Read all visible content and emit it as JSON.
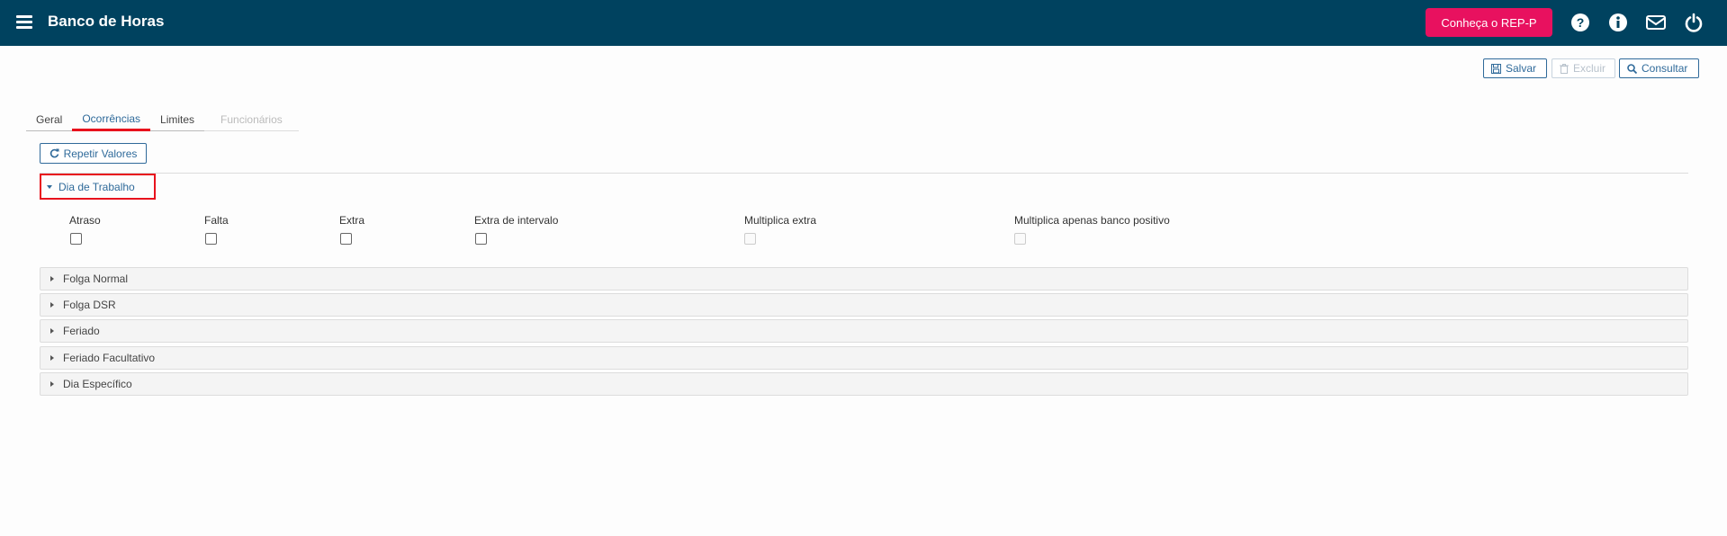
{
  "header": {
    "title": "Banco de Horas",
    "promo_label": "Conheça o REP-P",
    "icons": [
      "menu-icon",
      "help-icon",
      "info-icon",
      "mail-icon",
      "power-icon"
    ],
    "bg_color": "#00425f",
    "promo_color": "#e8115f"
  },
  "toolbar": {
    "save_label": "Salvar",
    "delete_label": "Excluir",
    "query_label": "Consultar"
  },
  "tabs": [
    {
      "label": "Geral",
      "state": "normal"
    },
    {
      "label": "Ocorrências",
      "state": "active"
    },
    {
      "label": "Limites",
      "state": "normal"
    },
    {
      "label": "Funcionários",
      "state": "disabled"
    }
  ],
  "repeat_label": "Repetir Valores",
  "work_day": {
    "title": "Dia de Trabalho",
    "fields": [
      {
        "label": "Atraso",
        "checked": false,
        "enabled": true
      },
      {
        "label": "Falta",
        "checked": false,
        "enabled": true
      },
      {
        "label": "Extra",
        "checked": false,
        "enabled": true
      },
      {
        "label": "Extra de intervalo",
        "checked": false,
        "enabled": true
      },
      {
        "label": "Multiplica extra",
        "checked": false,
        "enabled": false
      },
      {
        "label": "Multiplica apenas banco positivo",
        "checked": false,
        "enabled": false
      }
    ]
  },
  "panels": [
    "Folga Normal",
    "Folga DSR",
    "Feriado",
    "Feriado Facultativo",
    "Dia Específico"
  ],
  "accent_color": "#2f6a9a",
  "highlight_color": "#e8121d"
}
